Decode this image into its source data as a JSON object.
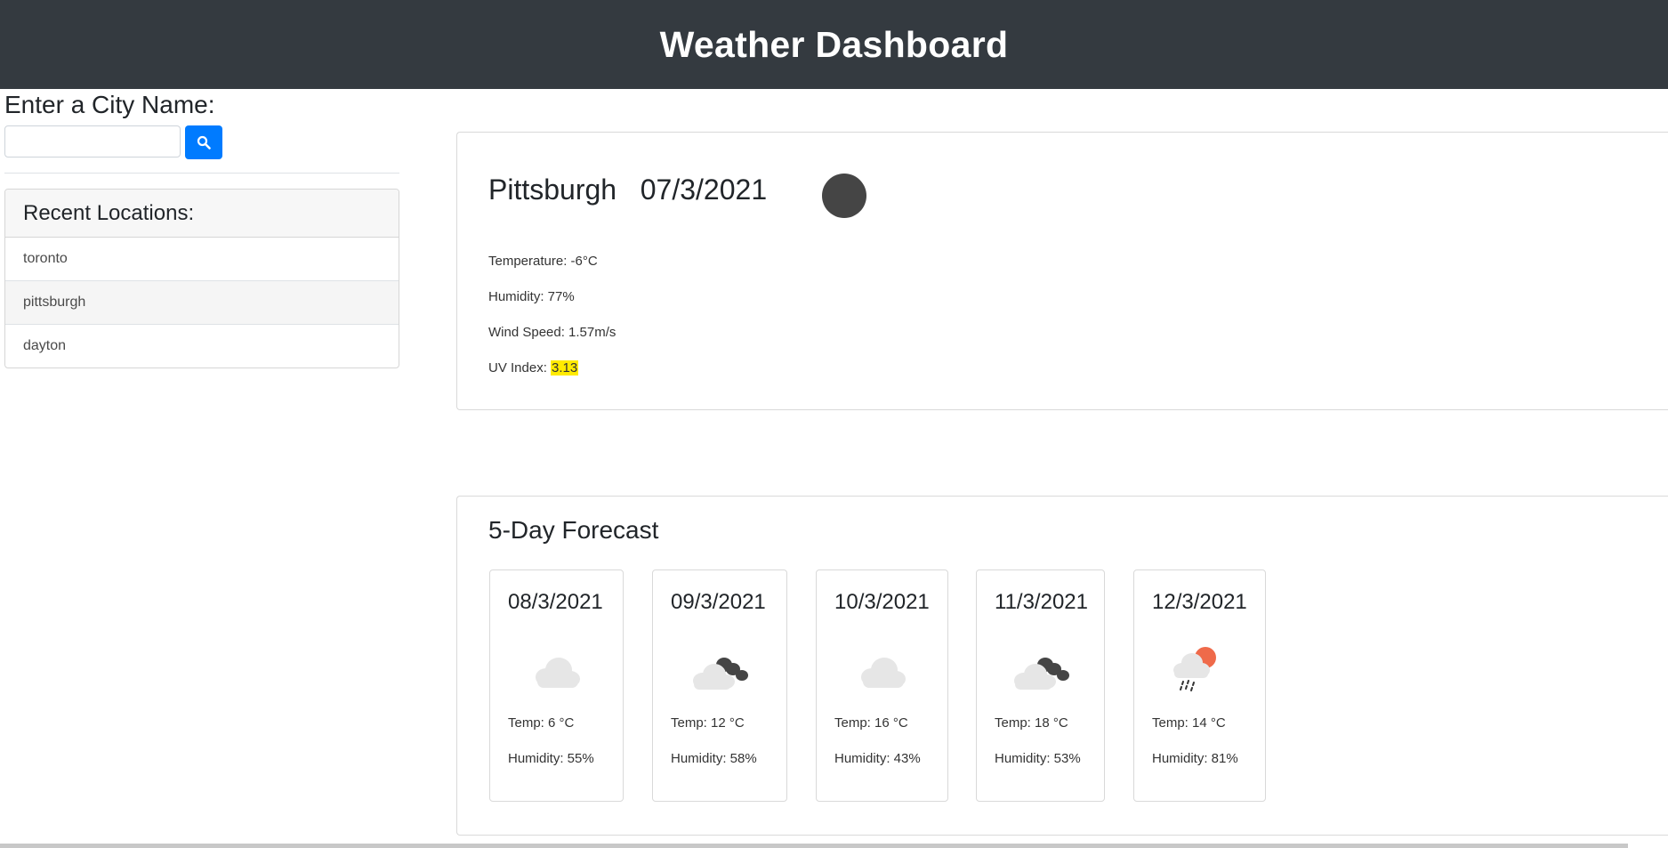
{
  "header": {
    "title": "Weather Dashboard"
  },
  "search": {
    "label": "Enter a City Name:",
    "value": "",
    "button_icon": "search-icon"
  },
  "recent": {
    "title": "Recent Locations:",
    "items": [
      {
        "label": "toronto",
        "active": false
      },
      {
        "label": "pittsburgh",
        "active": true
      },
      {
        "label": "dayton",
        "active": false
      }
    ]
  },
  "current": {
    "city": "Pittsburgh",
    "date": "07/3/2021",
    "icon": "weather-icon",
    "temperature": "Temperature: -6°C",
    "humidity": "Humidity: 77%",
    "wind": "Wind Speed: 1.57m/s",
    "uv_label": "UV Index: ",
    "uv_value": "3.13",
    "uv_color": "#ffeb00"
  },
  "forecast": {
    "title": "5-Day Forecast",
    "days": [
      {
        "date": "08/3/2021",
        "icon": "cloud-icon",
        "temp": "Temp: 6 °C",
        "humidity": "Humidity: 55%"
      },
      {
        "date": "09/3/2021",
        "icon": "broken-clouds-icon",
        "temp": "Temp: 12 °C",
        "humidity": "Humidity: 58%"
      },
      {
        "date": "10/3/2021",
        "icon": "cloud-icon",
        "temp": "Temp: 16 °C",
        "humidity": "Humidity: 43%"
      },
      {
        "date": "11/3/2021",
        "icon": "broken-clouds-icon",
        "temp": "Temp: 18 °C",
        "humidity": "Humidity: 53%"
      },
      {
        "date": "12/3/2021",
        "icon": "rain-sun-icon",
        "temp": "Temp: 14 °C",
        "humidity": "Humidity: 81%"
      }
    ]
  },
  "colors": {
    "header_bg": "#343a40",
    "primary": "#007bff",
    "uv_highlight": "#ffeb00"
  }
}
